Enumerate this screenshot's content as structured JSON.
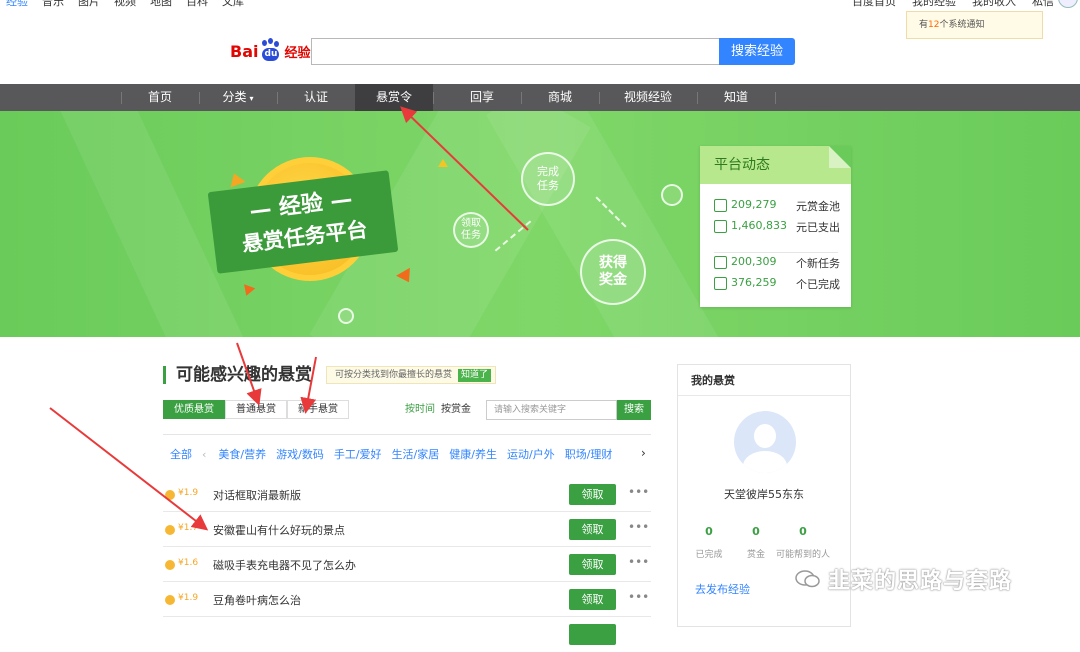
{
  "top_nav": {
    "left_links": [
      "经验",
      "音乐",
      "图片",
      "视频",
      "地图",
      "百科",
      "文库"
    ],
    "right_links": [
      "百度首页",
      "我的经验",
      "我的收入",
      "私信"
    ]
  },
  "notice": {
    "prefix": "有",
    "count": "12",
    "suffix": "个系统通知"
  },
  "logo": {
    "bai": "Bai",
    "jingyan": "经验"
  },
  "search": {
    "button": "搜索经验",
    "value": ""
  },
  "main_nav": {
    "items": [
      "首页",
      "分类",
      "认证",
      "悬赏令",
      "回享",
      "商城",
      "视频经验",
      "知道"
    ],
    "active": "悬赏令"
  },
  "banner": {
    "ribbon_line1": "— 经验 —",
    "ribbon_line2": "悬赏任务平台",
    "step_get": "领取\n任务",
    "step_done": "完成\n任务",
    "step_reward": "获得\n奖金"
  },
  "platform": {
    "title": "平台动态",
    "stats": [
      {
        "value": "209,279",
        "label": "元赏金池",
        "icon": "yen-icon"
      },
      {
        "value": "1,460,833",
        "label": "元已支出",
        "icon": "wallet-icon"
      },
      {
        "value": "200,309",
        "label": "个新任务",
        "icon": "list-icon"
      },
      {
        "value": "376,259",
        "label": "个已完成",
        "icon": "check-icon"
      }
    ]
  },
  "section": {
    "title": "可能感兴趣的悬赏",
    "hint": "可按分类找到你最擅长的悬赏",
    "hint_tag": "知道了",
    "tabs": [
      "优质悬赏",
      "普通悬赏",
      "新手悬赏"
    ],
    "sort_time": "按时间",
    "sort_reward": "按赏金",
    "search_placeholder": "请输入搜索关键字",
    "search_button": "搜索",
    "categories": [
      "全部",
      "美食/营养",
      "游戏/数码",
      "手工/爱好",
      "生活/家居",
      "健康/养生",
      "运动/户外",
      "职场/理财"
    ],
    "rows": [
      {
        "price": "¥1.9",
        "title": "对话框取消最新版",
        "action": "领取"
      },
      {
        "price": "¥1.7",
        "title": "安徽霍山有什么好玩的景点",
        "action": "领取"
      },
      {
        "price": "¥1.6",
        "title": "磁吸手表充电器不见了怎么办",
        "action": "领取"
      },
      {
        "price": "¥1.9",
        "title": "豆角卷叶病怎么治",
        "action": "领取"
      }
    ]
  },
  "my_reward": {
    "title": "我的悬赏",
    "username": "天堂彼岸55东东",
    "stats": [
      {
        "value": "0",
        "label": "已完成"
      },
      {
        "value": "0",
        "label": "赏金"
      },
      {
        "value": "0",
        "label": "可能帮到的人"
      }
    ],
    "publish_link": "去发布经验"
  },
  "watermark": "韭菜的思路与套路",
  "colors": {
    "brand_green": "#3aa042",
    "link_blue": "#3385ff",
    "nav_gray": "#58585a",
    "annotation_red": "#e83a3a"
  }
}
